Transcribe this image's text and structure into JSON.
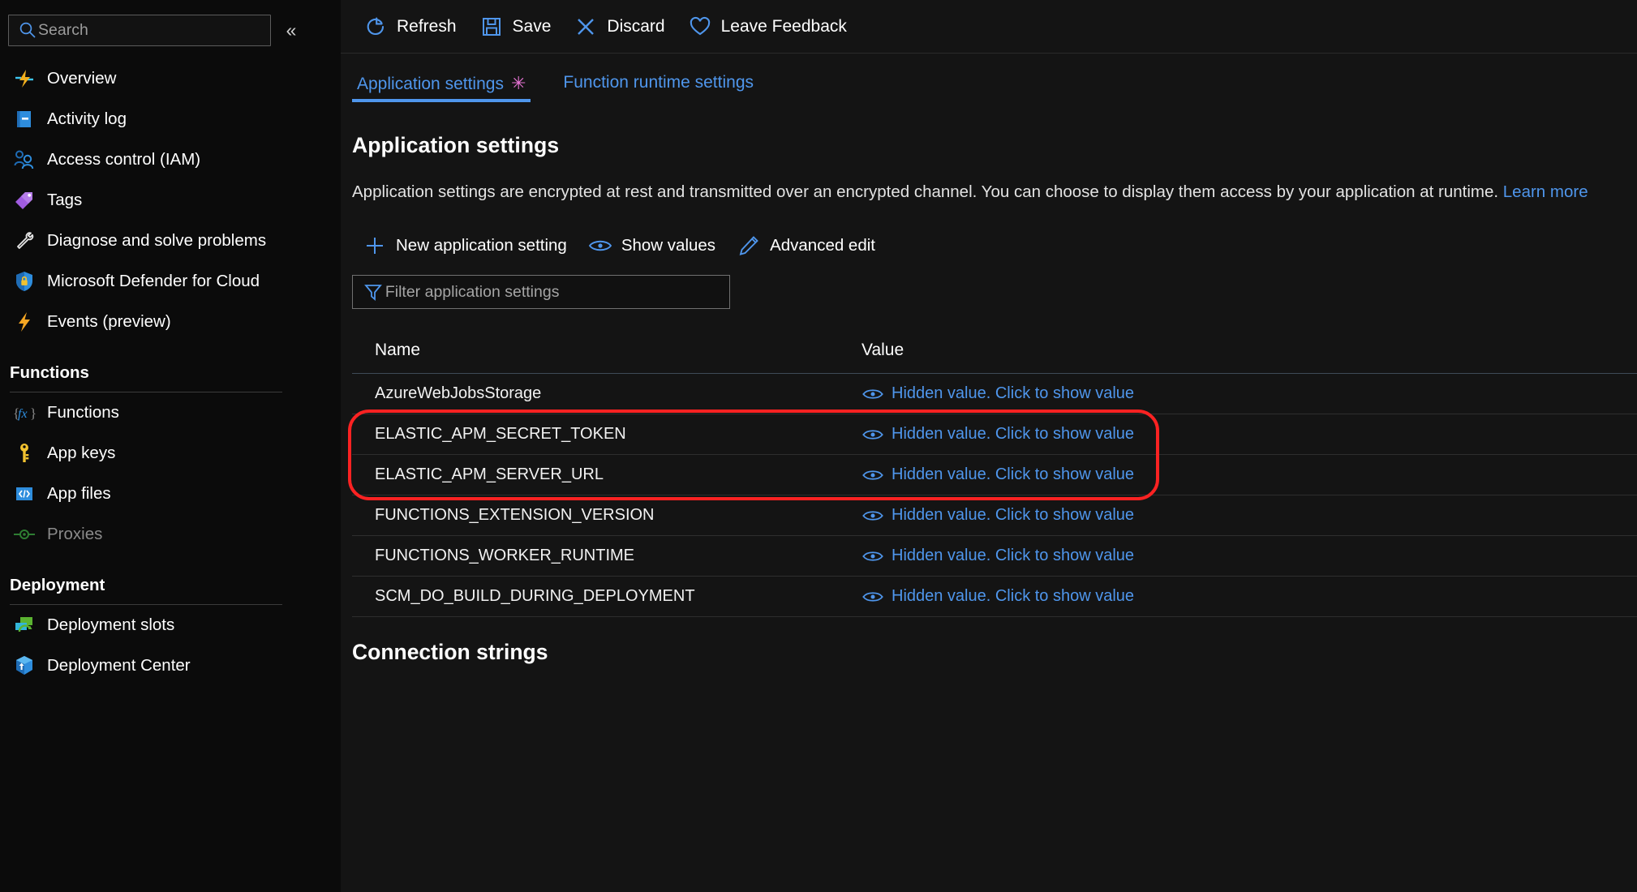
{
  "theme": {
    "bg_sidebar": "#0b0b0b",
    "bg_main": "#141414",
    "accent_blue": "#4f96ec",
    "dirty_marker": "#e774d5",
    "annotation_red": "#fb2222",
    "text_primary": "#ffffff"
  },
  "sidebar": {
    "search": {
      "placeholder": "Search",
      "value": "",
      "icon": "search-icon"
    },
    "collapse_label": "«",
    "items": [
      {
        "label": "Overview",
        "icon": "overview-lightning-icon",
        "disabled": false
      },
      {
        "label": "Activity log",
        "icon": "activity-log-icon",
        "disabled": false
      },
      {
        "label": "Access control (IAM)",
        "icon": "access-control-people-icon",
        "disabled": false
      },
      {
        "label": "Tags",
        "icon": "tags-icon",
        "disabled": false
      },
      {
        "label": "Diagnose and solve problems",
        "icon": "wrench-icon",
        "disabled": false
      },
      {
        "label": "Microsoft Defender for Cloud",
        "icon": "shield-lock-icon",
        "disabled": false
      },
      {
        "label": "Events (preview)",
        "icon": "events-lightning-icon",
        "disabled": false
      }
    ],
    "groups": [
      {
        "title": "Functions",
        "items": [
          {
            "label": "Functions",
            "icon": "fx-icon",
            "disabled": false
          },
          {
            "label": "App keys",
            "icon": "key-icon",
            "disabled": false
          },
          {
            "label": "App files",
            "icon": "code-file-icon",
            "disabled": false
          },
          {
            "label": "Proxies",
            "icon": "proxies-icon",
            "disabled": true
          }
        ]
      },
      {
        "title": "Deployment",
        "items": [
          {
            "label": "Deployment slots",
            "icon": "deployment-slots-icon",
            "disabled": false
          },
          {
            "label": "Deployment Center",
            "icon": "deployment-center-cube-icon",
            "disabled": false
          }
        ]
      }
    ]
  },
  "toolbar": {
    "buttons": [
      {
        "label": "Refresh",
        "icon": "refresh-icon"
      },
      {
        "label": "Save",
        "icon": "save-floppy-icon"
      },
      {
        "label": "Discard",
        "icon": "discard-x-icon"
      },
      {
        "label": "Leave Feedback",
        "icon": "heart-icon"
      }
    ]
  },
  "tabs": [
    {
      "label": "Application settings",
      "active": true,
      "dirty": "✳"
    },
    {
      "label": "Function runtime settings",
      "active": false,
      "dirty": ""
    }
  ],
  "main": {
    "title": "Application settings",
    "description_part1": "Application settings are encrypted at rest and transmitted over an encrypted channel. You can choose to display them",
    "description_part2": "access by your application at runtime.",
    "learn_more": "Learn more",
    "commands": [
      {
        "label": "New application setting",
        "icon": "plus-icon"
      },
      {
        "label": "Show values",
        "icon": "eye-icon"
      },
      {
        "label": "Advanced edit",
        "icon": "pencil-icon"
      }
    ],
    "filter": {
      "placeholder": "Filter application settings",
      "value": "",
      "icon": "funnel-icon"
    },
    "table": {
      "columns": [
        "Name",
        "Value"
      ],
      "hidden_value_text": "Hidden value. Click to show value",
      "rows": [
        {
          "name": "AzureWebJobsStorage",
          "value": "Hidden value. Click to show value",
          "highlighted": false
        },
        {
          "name": "ELASTIC_APM_SECRET_TOKEN",
          "value": "Hidden value. Click to show value",
          "highlighted": true
        },
        {
          "name": "ELASTIC_APM_SERVER_URL",
          "value": "Hidden value. Click to show value",
          "highlighted": true
        },
        {
          "name": "FUNCTIONS_EXTENSION_VERSION",
          "value": "Hidden value. Click to show value",
          "highlighted": false
        },
        {
          "name": "FUNCTIONS_WORKER_RUNTIME",
          "value": "Hidden value. Click to show value",
          "highlighted": false
        },
        {
          "name": "SCM_DO_BUILD_DURING_DEPLOYMENT",
          "value": "Hidden value. Click to show value",
          "highlighted": false
        }
      ]
    },
    "connection_strings_title": "Connection strings"
  }
}
